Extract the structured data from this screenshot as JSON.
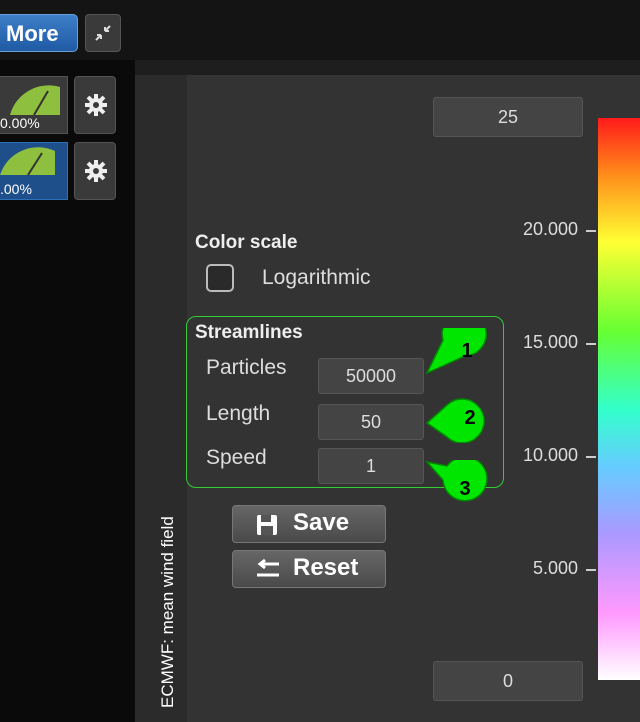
{
  "toolbar": {
    "more_label": "More"
  },
  "layers": [
    {
      "percent": "0.00%"
    },
    {
      "percent": ".00%"
    }
  ],
  "panel": {
    "side_title": "ECMWF: mean wind field",
    "max_value": "25",
    "min_value": "0",
    "ticks": [
      "20.000",
      "15.000",
      "10.000",
      "5.000"
    ],
    "color_scale": {
      "heading": "Color scale",
      "log_label": "Logarithmic",
      "log_checked": false
    },
    "streamlines": {
      "heading": "Streamlines",
      "particles_label": "Particles",
      "particles_value": "50000",
      "length_label": "Length",
      "length_value": "50",
      "speed_label": "Speed",
      "speed_value": "1"
    },
    "save_label": "Save",
    "reset_label": "Reset"
  },
  "callouts": [
    "1",
    "2",
    "3"
  ],
  "colors": {
    "accent": "#2d6fb8",
    "highlight": "#33cc33",
    "callout": "#00e600"
  }
}
